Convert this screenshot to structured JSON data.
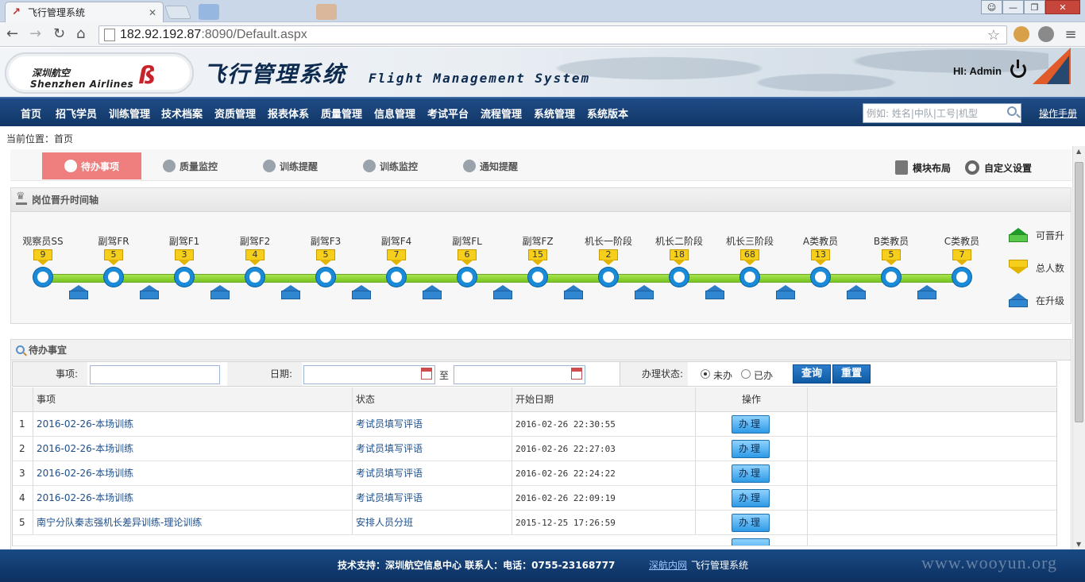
{
  "browser": {
    "tab_title": "飞行管理系统",
    "url_host": "182.92.192.87",
    "url_rest": ":8090/Default.aspx",
    "window_buttons": [
      "—",
      "❐",
      "✕"
    ]
  },
  "header": {
    "logo_cn": "深圳航空",
    "logo_en": "Shenzhen Airlines",
    "system_cn": "飞行管理系统",
    "system_en": "Flight Management System",
    "greeting": "HI: Admin"
  },
  "nav": {
    "items": [
      "首页",
      "招飞学员",
      "训练管理",
      "技术档案",
      "资质管理",
      "报表体系",
      "质量管理",
      "信息管理",
      "考试平台",
      "流程管理",
      "系统管理",
      "系统版本"
    ],
    "search_placeholder": "例如: 姓名|中队|工号|机型",
    "manual": "操作手册"
  },
  "breadcrumb": "当前位置：首页",
  "subtabs": {
    "items": [
      "待办事项",
      "质量监控",
      "训练提醒",
      "训练监控",
      "通知提醒"
    ],
    "layout": "模块布局",
    "custom": "自定义设置"
  },
  "timeline": {
    "title": "岗位晋升时间轴",
    "stages": [
      {
        "name": "观察员SS",
        "count": "9"
      },
      {
        "name": "副驾FR",
        "count": "5"
      },
      {
        "name": "副驾F1",
        "count": "3"
      },
      {
        "name": "副驾F2",
        "count": "4"
      },
      {
        "name": "副驾F3",
        "count": "5"
      },
      {
        "name": "副驾F4",
        "count": "7"
      },
      {
        "name": "副驾FL",
        "count": "6"
      },
      {
        "name": "副驾FZ",
        "count": "15"
      },
      {
        "name": "机长一阶段",
        "count": "2"
      },
      {
        "name": "机长二阶段",
        "count": "18"
      },
      {
        "name": "机长三阶段",
        "count": "68"
      },
      {
        "name": "A类教员",
        "count": "13"
      },
      {
        "name": "B类教员",
        "count": "5"
      },
      {
        "name": "C类教员",
        "count": "7"
      }
    ],
    "legend": [
      "可晋升",
      "总人数",
      "在升级"
    ]
  },
  "todo": {
    "title": "待办事宜",
    "filter": {
      "item_label": "事项:",
      "date_label": "日期:",
      "to_label": "至",
      "status_label": "办理状态:",
      "pending": "未办",
      "done": "已办",
      "query": "查询",
      "reset": "重置"
    },
    "columns": [
      "事项",
      "状态",
      "开始日期",
      "操作"
    ],
    "action_label": "办理",
    "rows": [
      {
        "no": "1",
        "item": "2016-02-26-本场训练",
        "status": "考试员填写评语",
        "date": "2016-02-26 22:30:55"
      },
      {
        "no": "2",
        "item": "2016-02-26-本场训练",
        "status": "考试员填写评语",
        "date": "2016-02-26 22:27:03"
      },
      {
        "no": "3",
        "item": "2016-02-26-本场训练",
        "status": "考试员填写评语",
        "date": "2016-02-26 22:24:22"
      },
      {
        "no": "4",
        "item": "2016-02-26-本场训练",
        "status": "考试员填写评语",
        "date": "2016-02-26 22:09:19"
      },
      {
        "no": "5",
        "item": "南宁分队秦志强机长差异训练-理论训练",
        "status": "安排人员分班",
        "date": "2015-12-25 17:26:59"
      }
    ]
  },
  "footer": {
    "support": "技术支持：深圳航空信息中心 联系人：电话：0755-23168777",
    "link": "深航内网",
    "system": "飞行管理系统",
    "watermark": "www.wooyun.org"
  }
}
